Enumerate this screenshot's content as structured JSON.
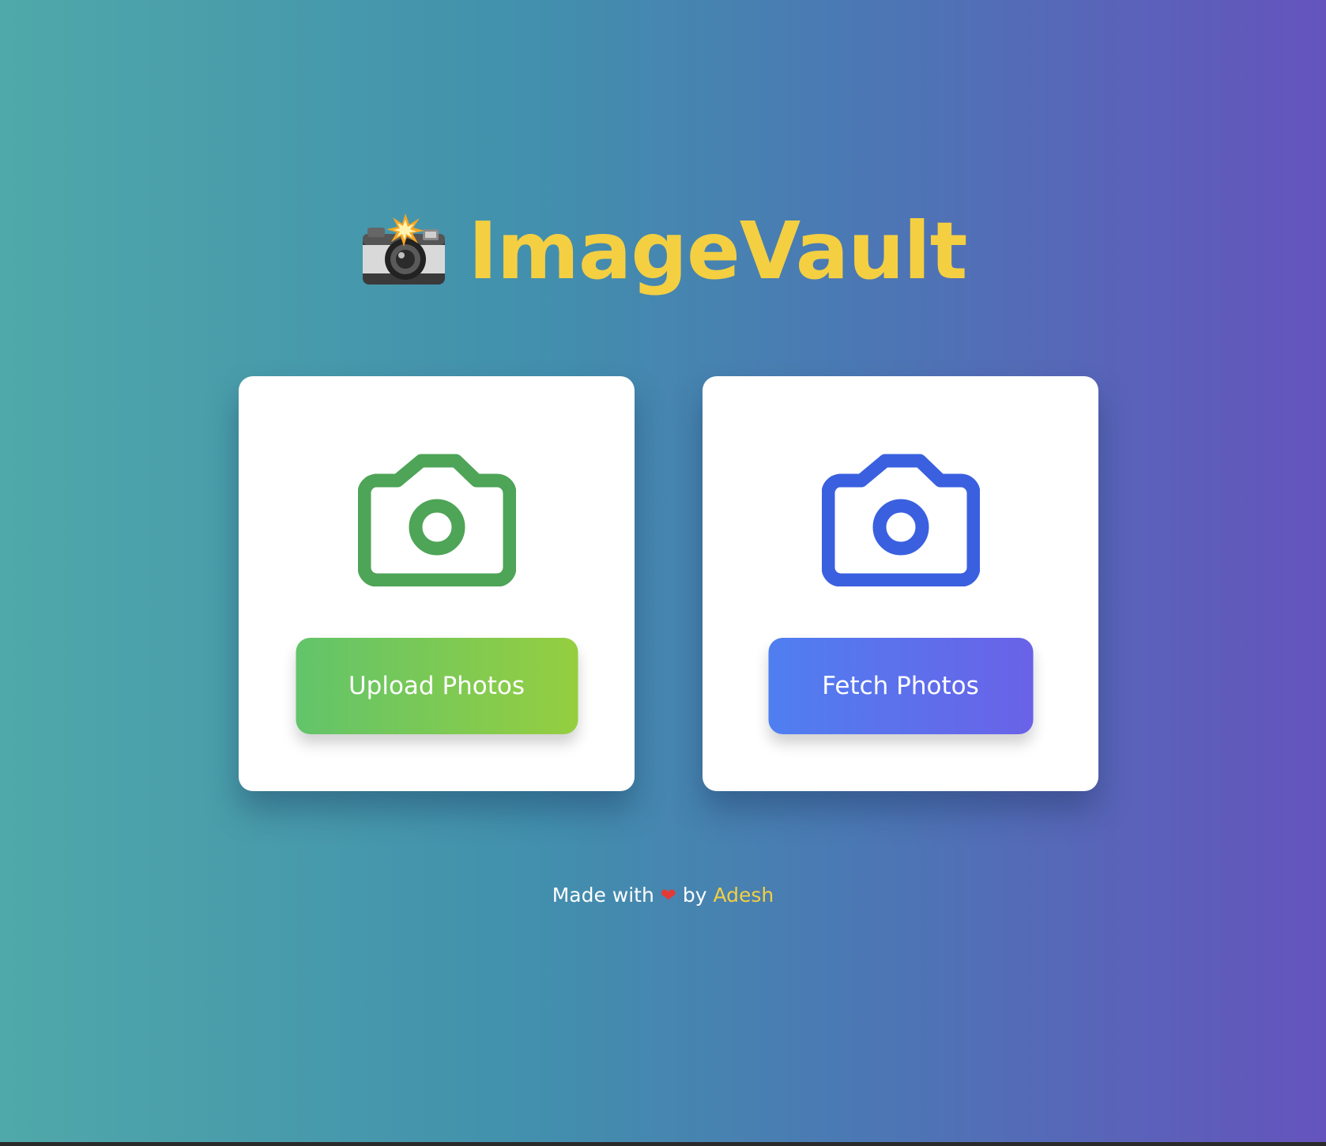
{
  "header": {
    "title": "ImageVault",
    "icon": "camera-flash-icon"
  },
  "cards": {
    "upload": {
      "icon": "camera-icon",
      "icon_color": "#4ea457",
      "button_label": "Upload Photos",
      "button_gradient": [
        "#62c46a",
        "#95ce40"
      ]
    },
    "fetch": {
      "icon": "camera-icon",
      "icon_color": "#3a60e0",
      "button_label": "Fetch Photos",
      "button_gradient": [
        "#4f7ff0",
        "#6a62e8"
      ]
    }
  },
  "footer": {
    "prefix": "Made with",
    "heart": "❤",
    "by": "by",
    "author": "Adesh"
  },
  "colors": {
    "title": "#f4cf42",
    "background_gradient": [
      "#4fa8a9",
      "#4290ad",
      "#4b78b4",
      "#6553bd"
    ]
  }
}
